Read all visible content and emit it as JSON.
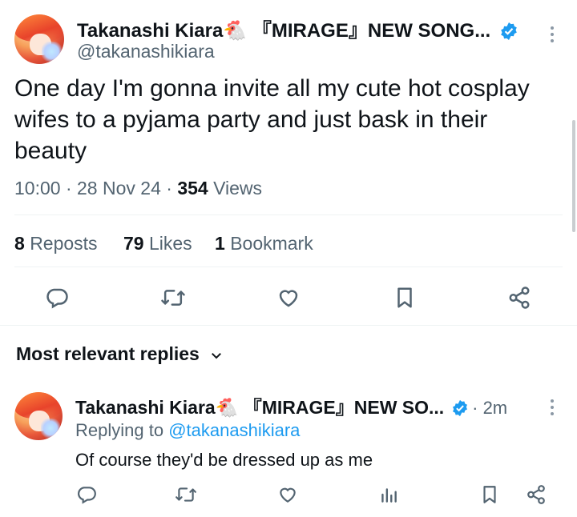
{
  "tweet": {
    "author_name": "Takanashi Kiara🐔 『MIRAGE』NEW SONG...",
    "handle": "@takanashikiara",
    "text": "One day I'm gonna invite all my cute hot cosplay wifes to a pyjama party and just bask in their beauty",
    "time": "10:00",
    "date": "28 Nov 24",
    "views_count": "354",
    "views_label": "Views",
    "reposts_count": "8",
    "reposts_label": "Reposts",
    "likes_count": "79",
    "likes_label": "Likes",
    "bookmarks_count": "1",
    "bookmarks_label": "Bookmark"
  },
  "replies": {
    "header": "Most relevant replies",
    "items": [
      {
        "author_name": "Takanashi Kiara🐔 『MIRAGE』NEW SO...",
        "time_ago": "2m",
        "replying_prefix": "Replying to",
        "replying_handle": "@takanashikiara",
        "text": "Of course they'd be dressed up as me"
      }
    ]
  },
  "colors": {
    "accent": "#1d9bf0",
    "text": "#0f1419",
    "muted": "#536471",
    "divider": "#eff3f4"
  }
}
